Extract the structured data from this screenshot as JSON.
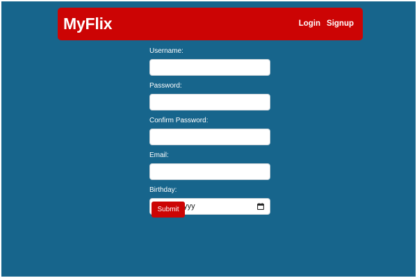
{
  "navbar": {
    "brand": "MyFlix",
    "links": [
      "Login",
      "Signup"
    ]
  },
  "form": {
    "username_label": "Username:",
    "username_value": "",
    "password_label": "Password:",
    "password_value": "",
    "confirm_password_label": "Confirm Password:",
    "confirm_password_value": "",
    "email_label": "Email:",
    "email_value": "",
    "birthday_label": "Birthday:",
    "birthday_placeholder": "dd/mm/yyyy",
    "submit_label": "Submit"
  },
  "icons": {
    "birthday_picker": "calendar-icon"
  },
  "colors": {
    "background": "#17658c",
    "navbar": "#cc0404",
    "button": "#cc0404",
    "text": "#ffffff"
  }
}
